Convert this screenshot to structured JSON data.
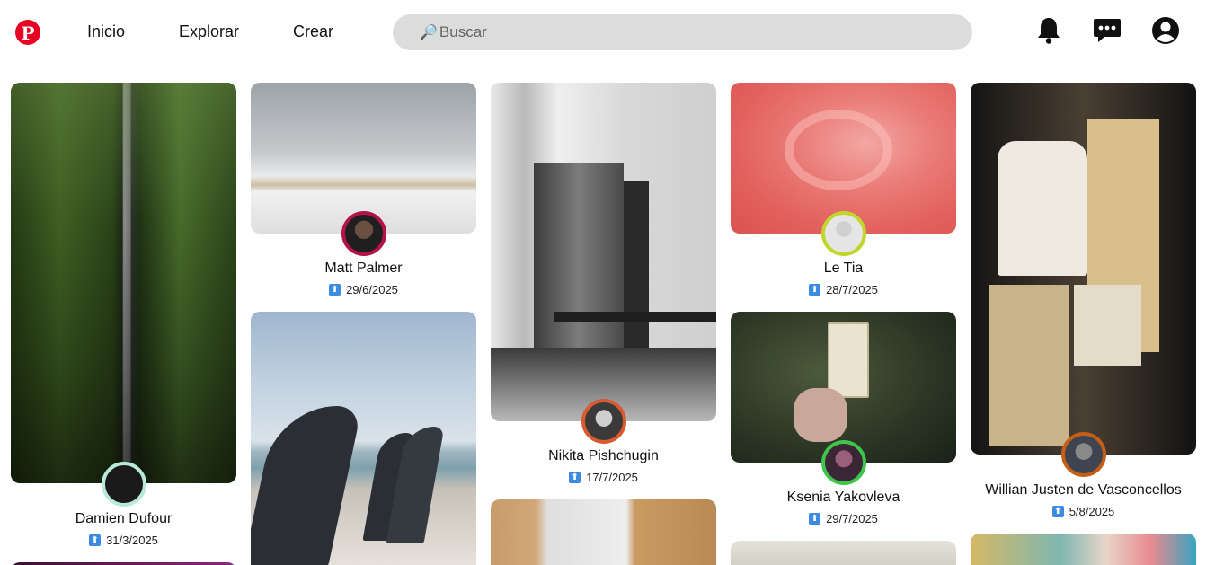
{
  "header": {
    "logo_letter": "P",
    "nav": {
      "home": "Inicio",
      "explore": "Explorar",
      "create": "Crear"
    },
    "search_placeholder": "Buscar",
    "icons": [
      "bell-icon",
      "chat-icon",
      "account-icon"
    ]
  },
  "pins": [
    {
      "author": "Damien Dufour",
      "date": "31/3/2025",
      "ring": "#b7ead8"
    },
    {
      "author": "Matt Palmer",
      "date": "29/6/2025",
      "ring": "#b3124a"
    },
    {
      "author": "Nikita Pishchugin",
      "date": "17/7/2025",
      "ring": "#d85a2f"
    },
    {
      "author": "Le Tia",
      "date": "28/7/2025",
      "ring": "#c2d62a"
    },
    {
      "author": "Ksenia Yakovleva",
      "date": "29/7/2025",
      "ring": "#3fc54a"
    },
    {
      "author": "Willian Justen de Vasconcellos",
      "date": "5/8/2025",
      "ring": "#c45f18"
    }
  ],
  "colors": {
    "brand": "#e60023",
    "search_bg": "#dcdcdc",
    "upload_badge": "#3d8be0"
  }
}
